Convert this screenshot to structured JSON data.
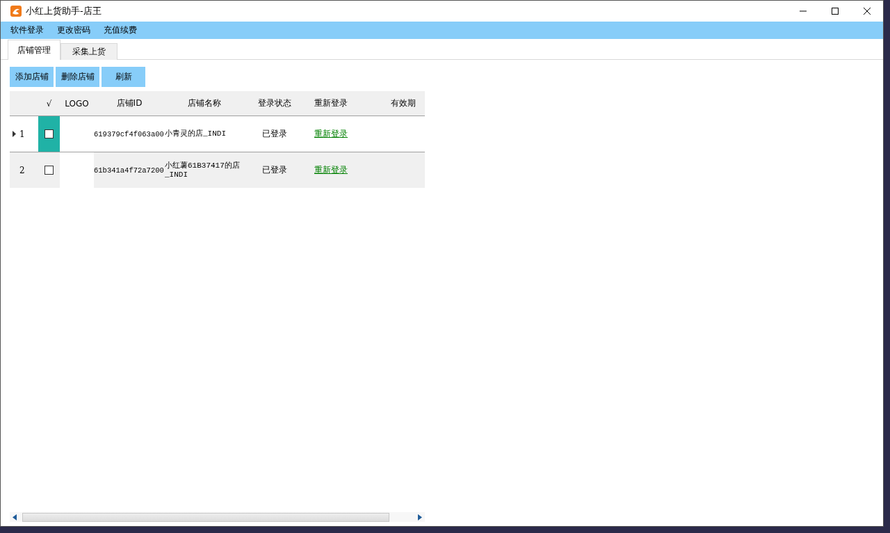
{
  "window": {
    "title": "小红上货助手-店王"
  },
  "menu": [
    "软件登录",
    "更改密码",
    "充值续费"
  ],
  "tabs": [
    {
      "label": "店铺管理",
      "selected": true
    },
    {
      "label": "采集上货",
      "selected": false
    }
  ],
  "toolbar": [
    "添加店铺",
    "删除店铺",
    "刷新"
  ],
  "table": {
    "columns": [
      "√",
      "LOGO",
      "店铺ID",
      "店铺名称",
      "登录状态",
      "重新登录",
      "有效期"
    ],
    "rows": [
      {
        "number": "1",
        "selected": true,
        "checked": false,
        "id": "619379cf4f063a00",
        "name": "小青灵的店_INDI",
        "status": "已登录",
        "relogin": "重新登录"
      },
      {
        "number": "2",
        "selected": false,
        "checked": false,
        "id": "61b341a4f72a7200",
        "name": "小红薯61B37417的店_INDI",
        "status": "已登录",
        "relogin": "重新登录"
      }
    ]
  }
}
